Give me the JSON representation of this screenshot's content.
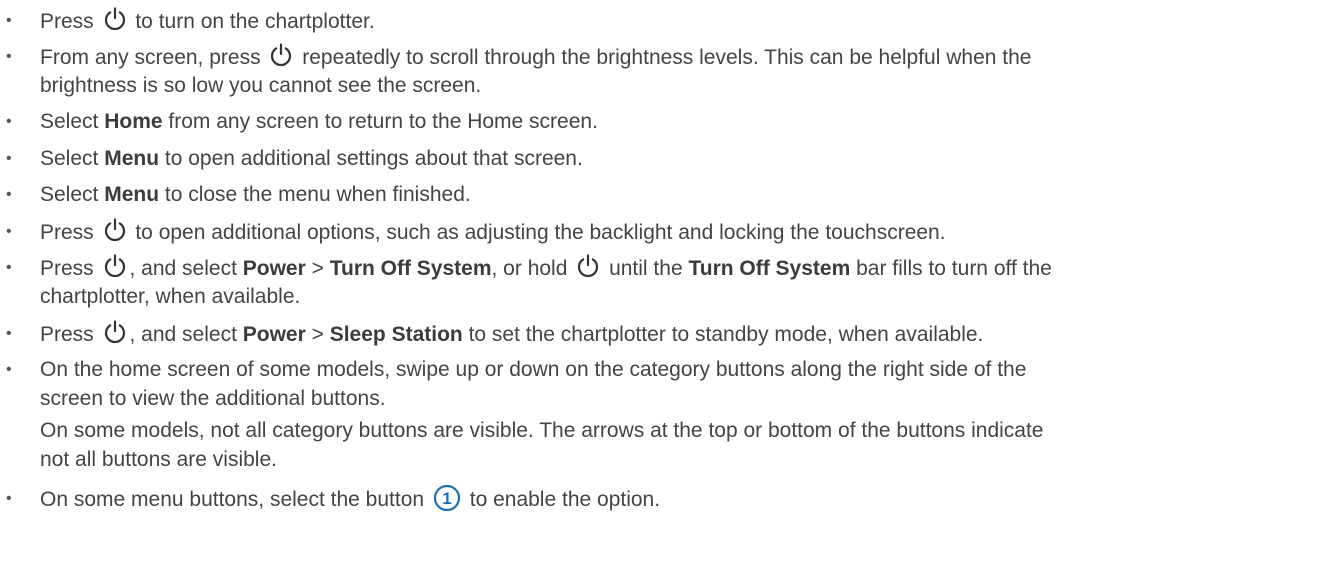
{
  "icons": {
    "power": "power-icon",
    "callout_number": "1",
    "callout_color": "#1a6fb3"
  },
  "items": [
    {
      "lines": [
        {
          "segs": [
            {
              "t": "Press "
            },
            {
              "icon": "power"
            },
            {
              "t": " to turn on the chartplotter."
            }
          ]
        }
      ]
    },
    {
      "lines": [
        {
          "segs": [
            {
              "t": "From any screen, press "
            },
            {
              "icon": "power"
            },
            {
              "t": " repeatedly to scroll through the brightness levels. This can be helpful when the"
            }
          ]
        },
        {
          "segs": [
            {
              "t": "brightness is so low you cannot see the screen."
            }
          ]
        }
      ]
    },
    {
      "lines": [
        {
          "segs": [
            {
              "t": "Select "
            },
            {
              "b": "Home"
            },
            {
              "t": " from any screen to return to the Home screen."
            }
          ]
        }
      ]
    },
    {
      "lines": [
        {
          "segs": [
            {
              "t": "Select "
            },
            {
              "b": "Menu"
            },
            {
              "t": " to open additional settings about that screen."
            }
          ]
        }
      ]
    },
    {
      "lines": [
        {
          "segs": [
            {
              "t": "Select "
            },
            {
              "b": "Menu"
            },
            {
              "t": " to close the menu when finished."
            }
          ]
        }
      ]
    },
    {
      "lines": [
        {
          "segs": [
            {
              "t": "Press "
            },
            {
              "icon": "power"
            },
            {
              "t": " to open additional options, such as adjusting the backlight and locking the touchscreen."
            }
          ]
        }
      ]
    },
    {
      "lines": [
        {
          "segs": [
            {
              "t": "Press "
            },
            {
              "icon": "power"
            },
            {
              "t": ", and select "
            },
            {
              "b": "Power"
            },
            {
              "t": " > "
            },
            {
              "b": "Turn Off System"
            },
            {
              "t": ", or hold "
            },
            {
              "icon": "power"
            },
            {
              "t": " until the "
            },
            {
              "b": "Turn Off System"
            },
            {
              "t": " bar fills to turn off the"
            }
          ]
        },
        {
          "segs": [
            {
              "t": "chartplotter, when available."
            }
          ]
        }
      ]
    },
    {
      "lines": [
        {
          "segs": [
            {
              "t": "Press "
            },
            {
              "icon": "power"
            },
            {
              "t": ", and select "
            },
            {
              "b": "Power"
            },
            {
              "t": " > "
            },
            {
              "b": "Sleep Station"
            },
            {
              "t": " to set the chartplotter to standby mode, when available."
            }
          ]
        }
      ]
    },
    {
      "lines": [
        {
          "segs": [
            {
              "t": "On the home screen of some models, swipe up or down on the category buttons along the right side of the"
            }
          ]
        },
        {
          "segs": [
            {
              "t": "screen to view the additional buttons."
            }
          ]
        },
        {
          "segs": [
            {
              "t": "On some models, not all category buttons are visible. The arrows at the top or bottom of the buttons indicate"
            }
          ]
        },
        {
          "segs": [
            {
              "t": "not all buttons are visible."
            }
          ]
        }
      ]
    },
    {
      "lines": [
        {
          "segs": [
            {
              "t": "On some menu buttons, select the button "
            },
            {
              "icon": "callout"
            },
            {
              "t": " to enable the option."
            }
          ]
        }
      ]
    }
  ]
}
